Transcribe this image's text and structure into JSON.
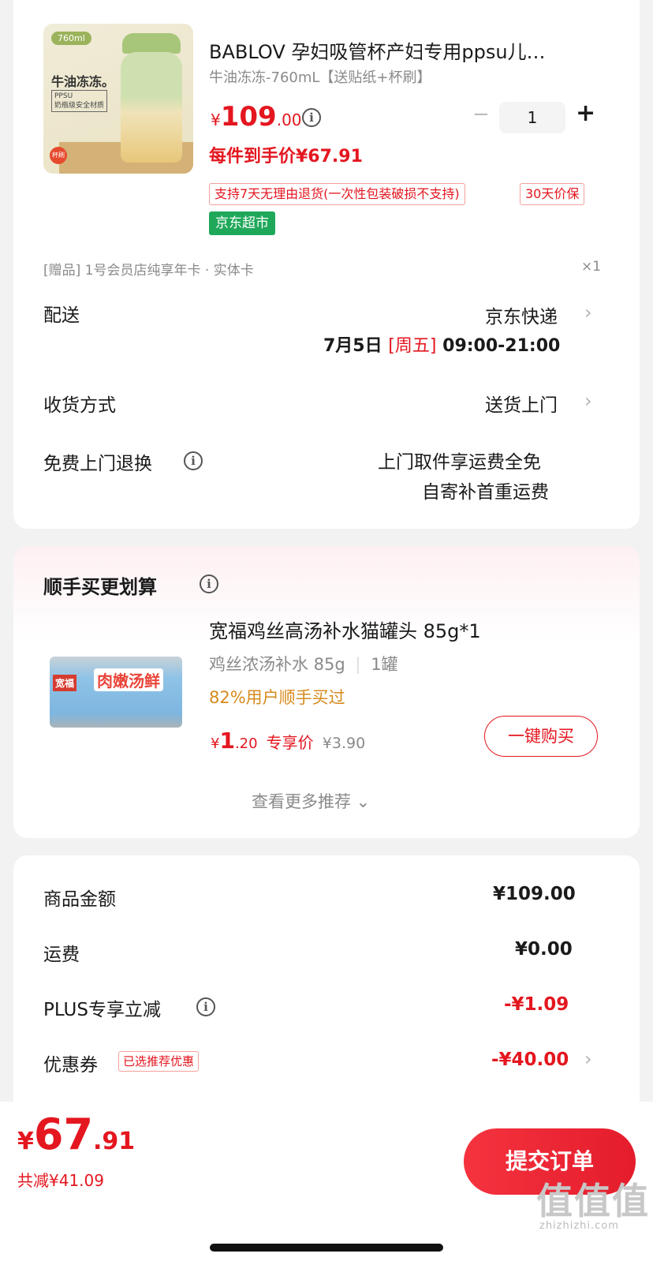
{
  "product": {
    "image_badge": "760ml",
    "image_slogan": "牛油冻冻。",
    "image_material": "PPSU\n奶瓶级安全材质",
    "image_gift": "杯刷",
    "title": "BABLOV 孕妇吸管杯产妇专用ppsu儿…",
    "spec": "牛油冻冻-760mL【送贴纸+杯刷】",
    "price_symbol": "¥",
    "price_int": "109",
    "price_dec": ".00",
    "unit_price": "每件到手价¥67.91",
    "quantity": "1",
    "minus": "−",
    "plus": "+",
    "return_tag": "支持7天无理由退货(一次性包装破损不支持)",
    "price_protect_tag": "30天价保",
    "store_tag": "京东超市",
    "gift_line": "[赠品] 1号会员店纯享年卡 · 实体卡",
    "gift_count": "×1"
  },
  "delivery": {
    "label": "配送",
    "value": "京东快递",
    "date": "7月5日",
    "weekday": "[周五]",
    "time": "09:00-21:00"
  },
  "receive": {
    "label": "收货方式",
    "value": "送货上门"
  },
  "free_return": {
    "label": "免费上门退换",
    "line1": "上门取件享运费全免",
    "line2": "自寄补首重运费"
  },
  "addon": {
    "section_title": "顺手买更划算",
    "can_brand": "宽福",
    "can_title": "肉嫩汤鲜",
    "item_title": "宽福鸡丝高汤补水猫罐头 85g*1",
    "item_spec": "鸡丝浓汤补水 85g",
    "item_count": "1罐",
    "bought_ratio": "82%用户顺手买过",
    "price_symbol": "¥",
    "price_int": "1",
    "price_dec": ".20",
    "exclusive": "专享价",
    "orig_price": "¥3.90",
    "buy_button": "一键购买",
    "more": "查看更多推荐 ⌄"
  },
  "summary": {
    "goods_label": "商品金额",
    "goods_value": "¥109.00",
    "shipping_label": "运费",
    "shipping_value": "¥0.00",
    "plus_label": "PLUS专享立减",
    "plus_value": "-¥1.09",
    "coupon_label": "优惠券",
    "coupon_tag": "已选推荐优惠",
    "coupon_value": "-¥40.00"
  },
  "footer": {
    "total_symbol": "¥",
    "total_int": "67",
    "total_dec": ".91",
    "saved": "共减¥41.09",
    "submit": "提交订单",
    "watermark": "值值值",
    "watermark_url": "zhizhizhi.com"
  },
  "colors": {
    "accent": "#e4161f",
    "store_green": "#1fa85a",
    "page_bg": "#f2f2f2"
  }
}
